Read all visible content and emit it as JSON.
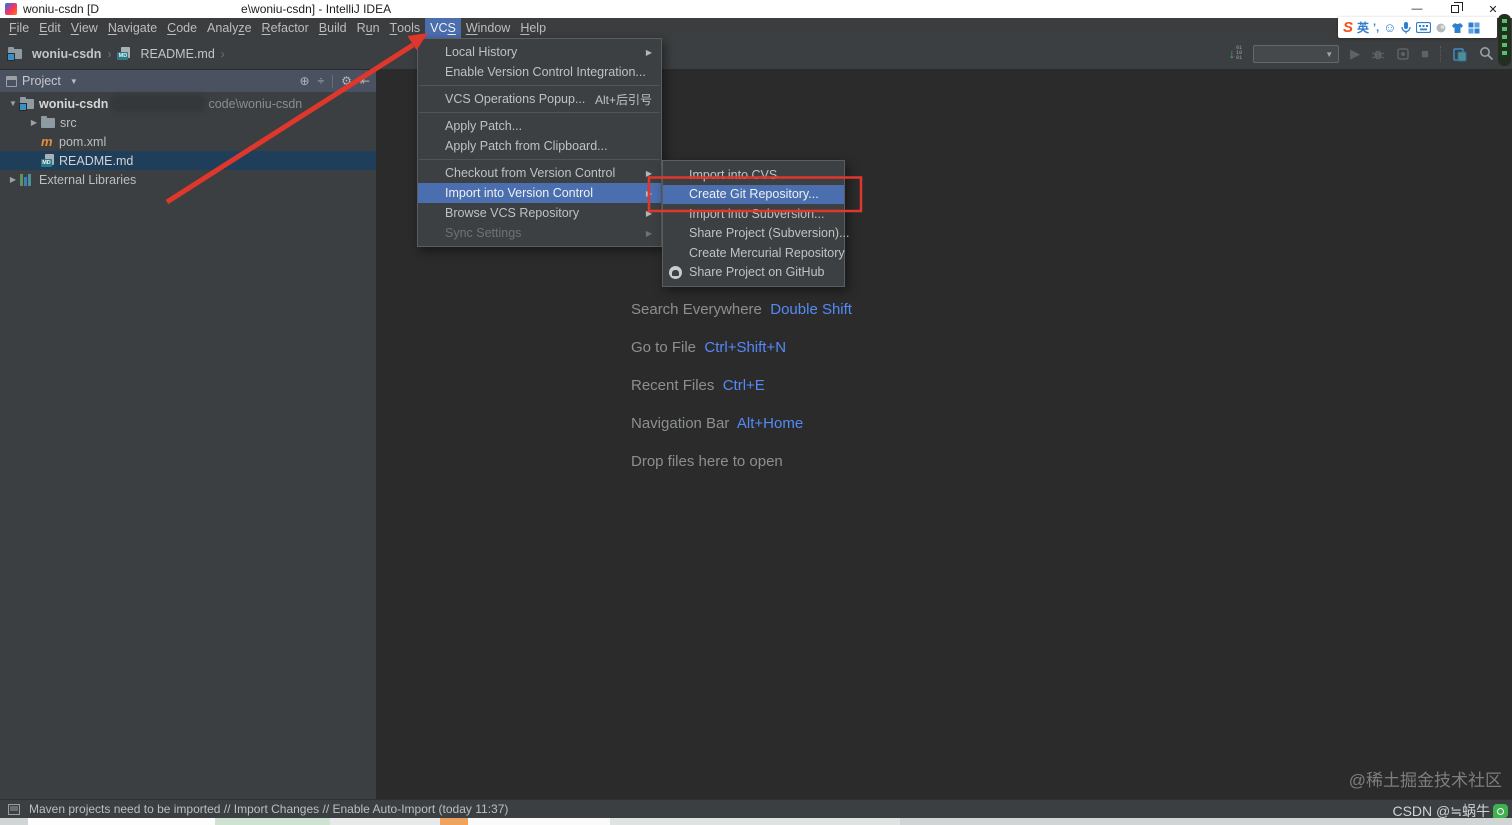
{
  "colors": {
    "selection_blue": "#4b6eaf",
    "shortcut_key_blue": "#548af7",
    "annotation_red": "#e0372c",
    "selected_row": "#1f3e59",
    "editor_bg": "#2b2b2b",
    "panel_bg": "#3c3f41"
  },
  "icons": {
    "locate": "⊕",
    "collapse_all": "÷",
    "settings": "⚙",
    "hide_panel": "⇤",
    "caret_down": "▼",
    "caret_right": "▶",
    "submenu_arrow": "▶",
    "breadcrumb_separator": "›",
    "dropdown_caret": "▾",
    "run": "▶",
    "stop": "■",
    "minimize": "—",
    "close": "✕",
    "update_arrow": "↓"
  },
  "title_bar": {
    "text_before_blur": "woniu-csdn [D",
    "text_after_blur": "e\\woniu-csdn] - IntelliJ IDEA"
  },
  "menu_bar": {
    "items": [
      {
        "pre": "",
        "key": "F",
        "post": "ile"
      },
      {
        "pre": "",
        "key": "E",
        "post": "dit"
      },
      {
        "pre": "",
        "key": "V",
        "post": "iew"
      },
      {
        "pre": "",
        "key": "N",
        "post": "avigate"
      },
      {
        "pre": "",
        "key": "C",
        "post": "ode"
      },
      {
        "pre": "Analy",
        "key": "z",
        "post": "e"
      },
      {
        "pre": "",
        "key": "R",
        "post": "efactor"
      },
      {
        "pre": "",
        "key": "B",
        "post": "uild"
      },
      {
        "pre": "R",
        "key": "u",
        "post": "n"
      },
      {
        "pre": "",
        "key": "T",
        "post": "ools"
      },
      {
        "pre": "VC",
        "key": "S",
        "post": ""
      },
      {
        "pre": "",
        "key": "W",
        "post": "indow"
      },
      {
        "pre": "",
        "key": "H",
        "post": "elp"
      }
    ]
  },
  "sogou_bar": {
    "logo_letter": "S",
    "language": "英",
    "punctuation": "’,",
    "smiley": "☺"
  },
  "nav_bar": {
    "breadcrumbs": [
      "woniu-csdn",
      "README.md"
    ]
  },
  "run_toolbar": {
    "update_digits": [
      "01",
      "10",
      "01"
    ],
    "run_config_value": ""
  },
  "project_panel": {
    "header_title": "Project",
    "root": {
      "label": "woniu-csdn",
      "path_hint": "code\\woniu-csdn"
    },
    "items": [
      {
        "label": "src"
      },
      {
        "label": "pom.xml"
      },
      {
        "label": "README.md",
        "selected": true
      },
      {
        "label": "External Libraries"
      }
    ]
  },
  "vcs_menu": {
    "items": [
      {
        "label": "Local History"
      },
      {
        "label": "Enable Version Control Integration..."
      },
      {
        "label": "VCS Operations Popup...",
        "shortcut": "Alt+后引号"
      },
      {
        "label": "Apply Patch..."
      },
      {
        "label": "Apply Patch from Clipboard..."
      },
      {
        "label": "Checkout from Version Control"
      },
      {
        "label": "Import into Version Control"
      },
      {
        "label": "Browse VCS Repository"
      },
      {
        "label": "Sync Settings"
      }
    ]
  },
  "import_submenu": {
    "items": [
      {
        "label": "Import into CVS"
      },
      {
        "label": "Create Git Repository..."
      },
      {
        "label": "Import into Subversion..."
      },
      {
        "label": "Share Project (Subversion)..."
      },
      {
        "label": "Create Mercurial Repository"
      },
      {
        "label": "Share Project on GitHub"
      }
    ]
  },
  "editor": {
    "shortcut_hints": [
      {
        "label": "Search Everywhere",
        "keys": "Double Shift"
      },
      {
        "label": "Go to File",
        "keys": "Ctrl+Shift+N"
      },
      {
        "label": "Recent Files",
        "keys": "Ctrl+E"
      },
      {
        "label": "Navigation Bar",
        "keys": "Alt+Home"
      }
    ],
    "drop_hint": "Drop files here to open"
  },
  "status_bar": {
    "message": "Maven projects need to be imported // Import Changes // Enable Auto-Import (today 11:37)"
  },
  "watermarks": {
    "juejin": "@稀土掘金技术社区",
    "csdn": "CSDN @≒蜗牛"
  }
}
